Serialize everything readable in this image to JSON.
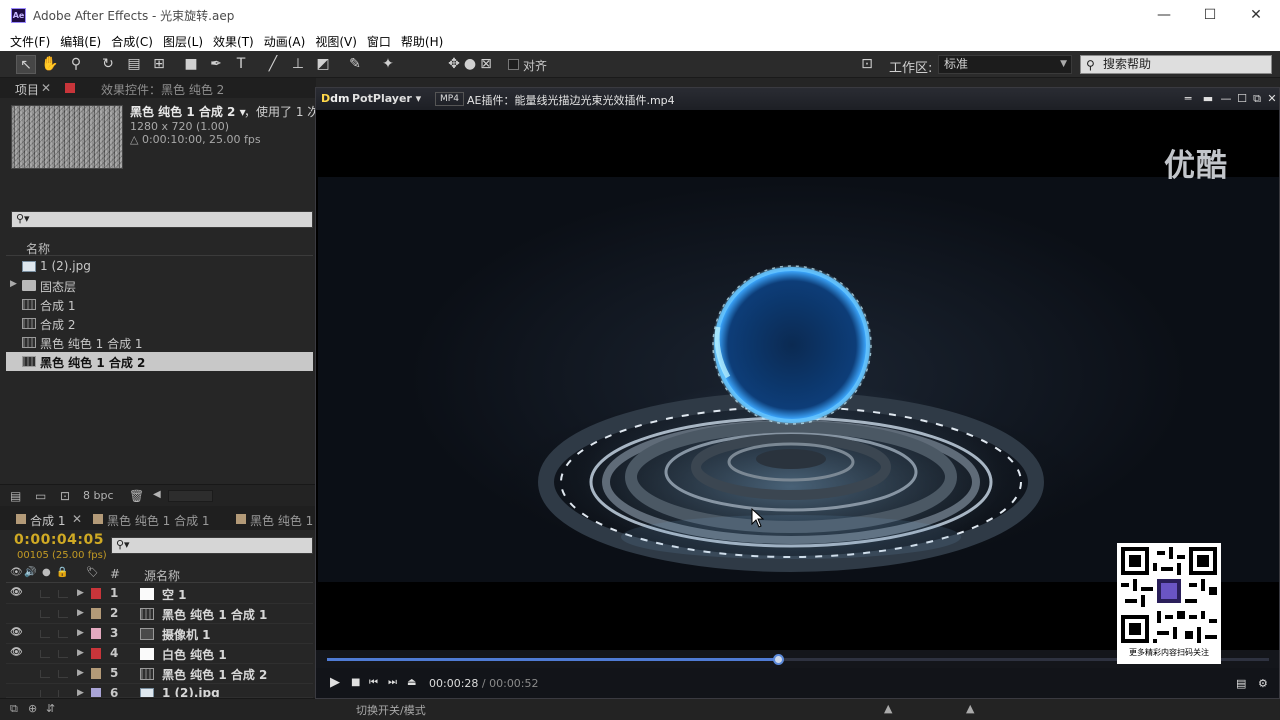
{
  "window": {
    "title": "Adobe After Effects - 光束旋转.aep",
    "logo": "Ae",
    "controls": [
      "minimize-icon",
      "maximize-icon",
      "close-icon"
    ]
  },
  "menu": [
    "文件(F)",
    "编辑(E)",
    "合成(C)",
    "图层(L)",
    "效果(T)",
    "动画(A)",
    "视图(V)",
    "窗口",
    "帮助(H)"
  ],
  "toolbar": {
    "snap_label": "对齐",
    "workspace_label": "工作区:",
    "workspace_value": "标准",
    "search_placeholder": "搜索帮助"
  },
  "project": {
    "tab_project": "项目",
    "tab_effects": "效果控件：黑色 纯色 2",
    "comp_name": "黑色 纯色 1 合成 2",
    "used": "，使用了 1 次",
    "resolution": "1280 x 720 (1.00)",
    "duration": "△ 0:00:10:00, 25.00 fps",
    "column_name": "名称",
    "items": [
      {
        "label": "1 (2).jpg",
        "icon": "image-file-icon"
      },
      {
        "label": "固态层",
        "icon": "folder-icon"
      },
      {
        "label": "合成 1",
        "icon": "composition-icon"
      },
      {
        "label": "合成 2",
        "icon": "composition-icon"
      },
      {
        "label": "黑色 纯色 1 合成 1",
        "icon": "composition-icon"
      },
      {
        "label": "黑色 纯色 1 合成 2",
        "icon": "composition-icon",
        "selected": true
      }
    ],
    "bpc": "8 bpc"
  },
  "timeline": {
    "tabs": [
      "合成 1",
      "黑色 纯色 1 合成 1",
      "黑色 纯色 1"
    ],
    "timecode": "0:00:04:05",
    "frames": "00105 (25.00 fps)",
    "column_num": "#",
    "column_source": "源名称",
    "layers": [
      {
        "num": "1",
        "name": "空 1",
        "color": "#c8353a"
      },
      {
        "num": "2",
        "name": "黑色 纯色 1 合成 1",
        "color": "#b39a78"
      },
      {
        "num": "3",
        "name": "摄像机 1",
        "color": "#e4aac0"
      },
      {
        "num": "4",
        "name": "白色 纯色 1",
        "color": "#c8353a"
      },
      {
        "num": "5",
        "name": "黑色 纯色 1 合成 2",
        "color": "#b39a78"
      },
      {
        "num": "6",
        "name": "1 (2).jpg",
        "color": "#a9a4d6"
      }
    ],
    "toggle_modes": "切换开关/模式"
  },
  "player": {
    "brand": "PotPlayer ▾",
    "format": "MP4",
    "filename": "AE插件：能量线光描边光束光效插件.mp4",
    "watermark": "优酷",
    "time_current": "00:00:28",
    "time_sep": " / ",
    "time_total": "00:00:52",
    "progress": 0.48,
    "qr_caption": "更多精彩内容扫码关注"
  },
  "colors": {
    "accent_blue": "#4f7bd4",
    "timecode": "#d0aa24",
    "label_red": "#c8353a"
  }
}
